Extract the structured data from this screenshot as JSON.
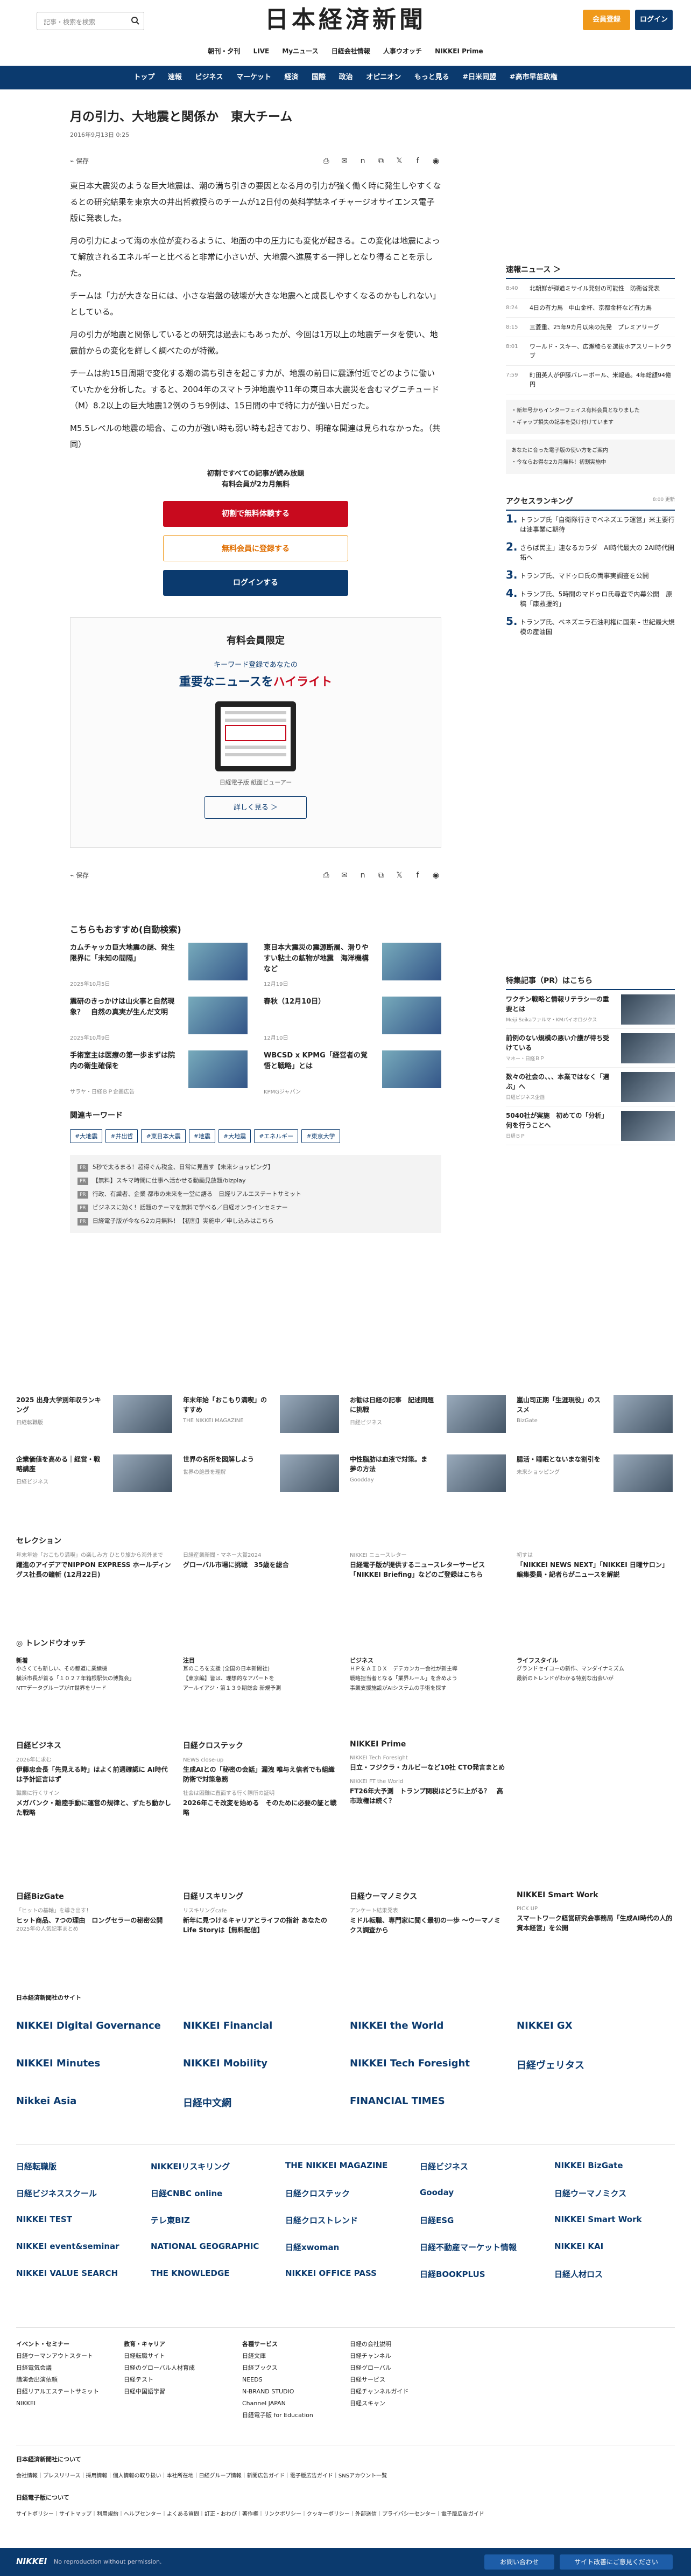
{
  "header": {
    "search_placeholder": "記事・検索を検索",
    "logo": "日本経済新聞",
    "register": "会員登録",
    "login": "ログイン",
    "subnav": [
      "朝刊・夕刊",
      "LIVE",
      "Myニュース",
      "日経会社情報",
      "人事ウオッチ",
      "NIKKEI Prime"
    ],
    "mainnav": [
      "トップ",
      "速報",
      "ビジネス",
      "マーケット",
      "経済",
      "国際",
      "政治",
      "オピニオン",
      "もっと見る",
      "#日米同盟",
      "#高市早苗政権"
    ]
  },
  "article": {
    "title": "月の引力、大地震と関係か　東大チーム",
    "date": "2016年9月13日 0:25",
    "save": "保存",
    "share_icons": [
      "print-icon",
      "mail-icon",
      "nikkei-icon",
      "link-icon",
      "x-icon",
      "facebook-icon",
      "line-icon"
    ],
    "paragraphs": [
      "東日本大震災のような巨大地震は、潮の満ち引きの要因となる月の引力が強く働く時に発生しやすくなるとの研究結果を東京大の井出哲教授らのチームが12日付の英科学誌ネイチャージオサイエンス電子版に発表した。",
      "月の引力によって海の水位が変わるように、地面の中の圧力にも変化が起きる。この変化は地震によって解放されるエネルギーと比べると非常に小さいが、大地震へ進展する一押しとなり得ることを示した。",
      "チームは「力が大きな日には、小さな岩盤の破壊が大きな地震へと成長しやすくなるのかもしれない」としている。",
      "月の引力が地震と関係しているとの研究は過去にもあったが、今回は1万以上の地震データを使い、地震前からの変化を詳しく調べたのが特徴。",
      "チームは約15日周期で変化する潮の満ち引きを起こす力が、地震の前日に震源付近でどのように働いていたかを分析した。すると、2004年のスマトラ沖地震や11年の東日本大震災を含むマグニチュード（M）8.2以上の巨大地震12例のうち9例は、15日間の中で特に力が強い日だった。",
      "M5.5レベルの地震の場合、この力が強い時も弱い時も起きており、明確な関連は見られなかった。（共同）"
    ]
  },
  "paywall": {
    "line1": "初割ですべての記事が読み放題",
    "line2": "有料会員が2カ月無料",
    "btn1": "初割で無料体験する",
    "btn2": "無料会員に登録する",
    "btn3": "ログインする"
  },
  "promo": {
    "heading": "有料会員限定",
    "sub": "キーワード登録であなたの",
    "tag_a": "重要なニュースを",
    "tag_b": "ハイライト",
    "caption": "日経電子版 紙面ビューアー",
    "more": "詳しく見る ＞"
  },
  "recommend": {
    "heading": "こちらもおすすめ(自動検索)",
    "items": [
      {
        "title": "カムチャッカ巨大地震の謎、発生限界に「未知の間隔」",
        "date": "2025年10月5日"
      },
      {
        "title": "東日本大震災の震源断層、滑りやすい粘土の鉱物が地震　海洋機構など",
        "date": "12月19日"
      },
      {
        "title": "震研のきっかけは山火事と自然現象？　自然の真実が生んだ文明",
        "date": "2025年10月9日"
      },
      {
        "title": "春秋（12月10日）",
        "date": "12月10日"
      },
      {
        "title": "手術室主は医療の第一歩まずは院内の衛生確保を",
        "date": "サラヤ・日経ＢＰ企画広告"
      },
      {
        "title": "WBCSD x KPMG「経営者の覚悟と戦略」とは",
        "date": "KPMGジャパン"
      }
    ]
  },
  "keywords": {
    "heading": "関連キーワード",
    "tags": [
      "#大地震",
      "#井出哲",
      "#東日本大震",
      "#地震",
      "#大地震",
      "#エネルギー",
      "#東京大学"
    ]
  },
  "pr_links": [
    "5秒で太るまる！超得ぐん税金、日常に見直す【未来ショッピング】",
    "【無料】スキマ時間に仕事へ活かせる動画見放題/bizplay",
    "行政、有識者、企業 都市の未来を一堂に語る　日経リアルエステートサミット",
    "ビジネスに効く！話題のテーマを無料で学べる／日経オンラインセミナー",
    "日経電子版が今なら2カ月無料！【初割】実施中／申し込みはこちら"
  ],
  "sidebar": {
    "breaking_heading": "速報ニュース",
    "breaking_more": "＞",
    "breaking": [
      {
        "time": "8:40",
        "text": "北朝鮮が弾道ミサイル発射の可能性　防衛省発表"
      },
      {
        "time": "8:24",
        "text": "4日の有力馬　中山金杯、京都金杯など有力馬"
      },
      {
        "time": "8:15",
        "text": "三菱重、25年9カ月以来の先発　プレミアリーグ"
      },
      {
        "time": "8:01",
        "text": "ワールド・スキー、広瀬稜らを選抜ホアスリートクラブ"
      },
      {
        "time": "7:59",
        "text": "町田英人が伊藤バレーボール、米報道。4年総額94億円"
      }
    ],
    "note_1": "・新年号からインターフェイス有料会員となりました",
    "note_2": "・ギャップ損失の記事を受け付けています",
    "note_3": "あなたに合った電子版の使い方をご案内",
    "note_4": "・今ならお得な2カ月無料！初割実施中",
    "ranking_heading": "アクセスランキング",
    "ranking_time": "8:00 更新",
    "ranking": [
      "トランプ氏「自衛隊行きでベネズエラ運営」米主要行は油事業に期待",
      "さらば民主」連なるカラダ　AI時代最大の 2AI時代開拓へ",
      "トランプ氏、マドゥロ氏の両事実調查を公開",
      "トランプ氏、5時間のマドゥロ氏尋査で内幕公開　原稿「康救援的」",
      "トランプ氏、ベネズエラ石油利権に国来 - 世紀最大規模の産油国"
    ],
    "pr_heading": "特集記事（PR）はこちら",
    "pr": [
      {
        "title": "ワクチン戦略と情報リテラシーの重要とは",
        "src": "Meiji Seikaファルマ・KMバイオロジクス"
      },
      {
        "title": "前例のない規模の悪い介護が待ち受けている",
        "src": "マネー・日経ＢＰ"
      },
      {
        "title": "数々の社会の、、、本業ではなく「選ぶ」へ",
        "src": "日経ビジネス企画"
      },
      {
        "title": "5040社が実施　初めての「分析」何を行うことへ",
        "src": "日経ＢＰ"
      }
    ]
  },
  "lower": {
    "ad_row1": [
      {
        "title": "2025 出身大学別年収ランキング",
        "sub": "日経転職版"
      },
      {
        "title": "年末年始「おこもり満喫」のすすめ",
        "sub": "THE NIKKEI MAGAZINE"
      },
      {
        "title": "お勧は日経の記事　記述問題に挑戦",
        "sub": "日経ビジネス"
      },
      {
        "title": "嵐山司正期「生涯現役」のススメ",
        "sub": "BizGate"
      }
    ],
    "ad_row2": [
      {
        "title": "企業価値を高める｜経営・戦略講座",
        "sub": "日経ビジネス"
      },
      {
        "title": "世界の名所を図解しよう",
        "sub": "世界の絶景を理解"
      },
      {
        "title": "中性脂肪は血液で対策。ま　夢の方法",
        "sub": "Goodday"
      },
      {
        "title": "腸活・睡眠とないまな割引を",
        "sub": "未来ショッピング"
      }
    ],
    "selection_heading": "セレクション",
    "selection": [
      {
        "lab": "年末年始「おこもり満喫」の楽しみ方 ひとり旅から海外まで",
        "title": "躍進のアイデアでNIPPON EXPRESS ホールディングス社長の鐘斬 (12月22日)"
      },
      {
        "lab": "日経産業新聞・マネー大賞2024",
        "title": "グローバル市場に挑戦　35歳を総合"
      },
      {
        "lab": "NIKKEI ニュースレター",
        "title": "日経電子版が提供するニュースレターサービス「NIKKEI Briefing」などのご登録はこちら"
      },
      {
        "lab": "初すは",
        "title": "「NIKKEI NEWS NEXT」「NIKKEI 日曜サロン」編集委員・記者らがニュースを解説"
      }
    ],
    "trend_heading": "トレンドウオッチ",
    "trend": [
      {
        "lab": "新着",
        "lines": [
          "小さくても新しい、その都道に業績機",
          "横浜市長が首る「１０２７年箱根駅伝の博覧会」",
          "NTTデータグループがIT世界をリード"
        ]
      },
      {
        "lab": "注目",
        "lines": [
          "耳のころを支援 (全国の日本新聞社)",
          "【東京編】皆は、理想的なアパートを",
          "アールイアジ・第１３９期総会 新規予測"
        ]
      },
      {
        "lab": "ビジネス",
        "lines": [
          "ＨＰをＡＩＤＸ　デテカンカー会社が新主導",
          "戦略担当者となる「業界ルール」を含めよう",
          "事業支援施設がAIシステムの手術を探す"
        ]
      },
      {
        "lab": "ライフスタイル",
        "lines": [
          "グランドセイコーの新作、マンダイナミズム",
          "最新のトレンドがわかる特別な出会いが"
        ]
      }
    ],
    "groups": [
      {
        "head": "日経ビジネス",
        "lab": "2026年に求む",
        "title": "伊藤忠会長「先見える時」はよく前週確認に AI時代は予計証言はず",
        "sub": "職業に行くサイン",
        "title2": "メガバンク・離陸手動に運営の規律と、ずたち動かした戦略"
      },
      {
        "head": "日経クロステック",
        "lab": "NEWS close-up",
        "title": "生成AIとの「秘密の会話」漏洩 唯与え信者でも組織防衛で対策急務",
        "sub": "社会は困難に直面する行く際所の証明",
        "title2": "2026年こそ改変を始める　そのために必要の証と戦略"
      },
      {
        "head": "NIKKEI Prime",
        "lab": "NIKKEI Tech Foresight",
        "title": "日立・フジクラ・カルビーなど10社 CTO発言まとめ",
        "sub": "NIKKEI FT the World",
        "title2": "FT26年大予測　トランプ関税はどうに上がる？　高市政権は続く？"
      }
    ],
    "groups2": [
      {
        "head": "日経BizGate",
        "lab": "「ヒットの基軸」を導き出す！",
        "title": "ヒット商品、7つの理由　ロングセラーの秘密公開",
        "sub": "2025年の人気記事まとめ"
      },
      {
        "head": "日経リスキリング",
        "lab": "リスキリングcafe",
        "title": "新年に見つけるキャリアとライフの指針 あなたのLife Storyは【無料配信】"
      },
      {
        "head": "日経ウーマノミクス",
        "lab": "アンケート結果発表",
        "title": "ミドル転職、専門家に聞く最初の一歩 ～ウーマノミクス調査から"
      },
      {
        "head": "NIKKEI Smart Work",
        "lab": "PICK UP",
        "title": "スマートワーク経営研究会事務局「生成AI時代の人的資本経営」を公開"
      }
    ],
    "partner_heading": "日本経済新聞社のサイト",
    "partners1": [
      "NIKKEI Digital Governance",
      "NIKKEI Financial",
      "NIKKEI the World",
      "NIKKEI GX",
      "NIKKEI Minutes",
      "NIKKEI Mobility",
      "NIKKEI Tech Foresight",
      "日経ヴェリタス",
      "Nikkei Asia",
      "日経中文網",
      "FINANCIAL TIMES"
    ],
    "partners2": [
      "日経転職版",
      "NIKKEIリスキリング",
      "THE NIKKEI MAGAZINE",
      "日経ビジネス",
      "NIKKEI BizGate",
      "日経ビジネススクール",
      "日経CNBC online",
      "日経クロステック",
      "Gooday",
      "日経ウーマノミクス",
      "NIKKEI TEST",
      "テレ東BIZ",
      "日経クロストレンド",
      "日経ESG",
      "NIKKEI Smart Work",
      "NIKKEI event&seminar",
      "NATIONAL GEOGRAPHIC",
      "日経xwoman",
      "日経不動産マーケット情報",
      "NIKKEI KAI",
      "NIKKEI VALUE SEARCH",
      "THE KNOWLEDGE",
      "NIKKEI OFFICE PASS",
      "日経BOOKPLUS",
      "日経人材ロス"
    ],
    "foot_cols": [
      {
        "head": "イベント・セミナー",
        "items": [
          "日経ウーマンアウトスタート",
          "日経電気会議",
          "講演会出演依頼",
          "日経リアルエステートサミット",
          "NIKKEI"
        ]
      },
      {
        "head": "教育・キャリア",
        "items": [
          "日経転職サイト",
          "日経のグローバル人材育成",
          "日経テスト",
          "日経中国語学習"
        ]
      },
      {
        "head": "各種サービス",
        "items": [
          "日経文庫",
          "日経ブックス",
          "NEEDS",
          "N-BRAND STUDIO",
          "Channel JAPAN",
          "日経電子版 for Education"
        ]
      },
      {
        "head": "",
        "items": [
          "日経の会社説明",
          "日経チャンネル",
          "日経グローバル",
          "日経サービス",
          "日経チャンネルガイド",
          "日経スキャン"
        ]
      }
    ],
    "about_heading": "日本経済新聞社について",
    "about": [
      "会社情報",
      "プレスリリース",
      "採用情報",
      "個人情報の取り扱い",
      "本社所在地",
      "日経グループ情報",
      "新聞広告ガイド",
      "電子版広告ガイド",
      "SNSアカウント一覧"
    ],
    "support_heading": "日経電子版について",
    "support": [
      "サイトポリシー",
      "サイトマップ",
      "利用規約",
      "ヘルプセンター",
      "よくある質問",
      "訂正・おわび",
      "著作権",
      "リンクポリシー",
      "クッキーポリシー",
      "外部送信",
      "プライバシーセンター",
      "電子版広告ガイド"
    ],
    "footer_brand": "NIKKEI",
    "footer_copy": "No reproduction without permission.",
    "footer_btn1": "お問い合わせ",
    "footer_btn2": "サイト改善にご意見ください"
  }
}
